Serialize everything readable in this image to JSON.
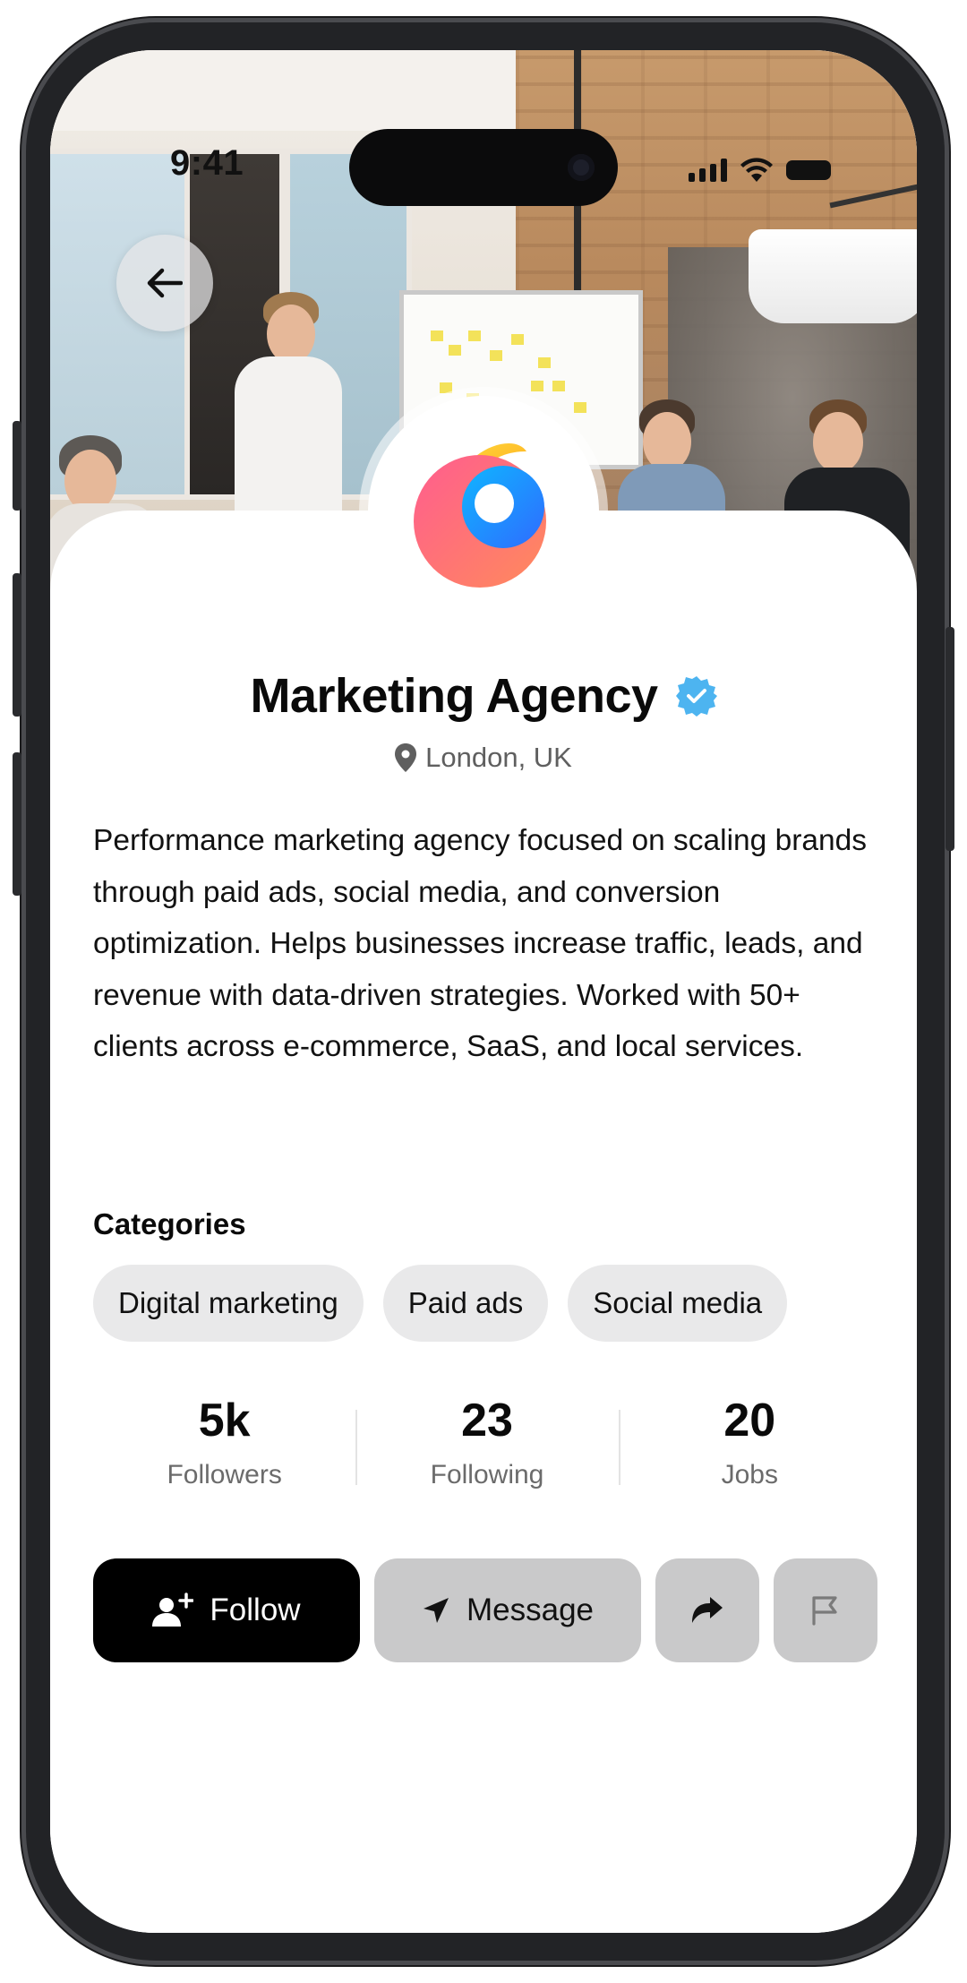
{
  "status_bar": {
    "time": "9:41"
  },
  "profile": {
    "name": "Marketing Agency",
    "verified": true,
    "location": "London, UK",
    "bio": "Performance marketing agency focused on scaling brands through paid ads, social media, and conversion optimization. Helps businesses increase traffic, leads, and revenue with data-driven strategies. Worked with 50+ clients across e-commerce, SaaS, and local services."
  },
  "categories": {
    "title": "Categories",
    "items": [
      "Digital marketing",
      "Paid ads",
      "Social media"
    ]
  },
  "stats": [
    {
      "value": "5k",
      "label": "Followers"
    },
    {
      "value": "23",
      "label": "Following"
    },
    {
      "value": "20",
      "label": "Jobs"
    }
  ],
  "actions": {
    "follow_label": "Follow",
    "message_label": "Message"
  },
  "icons": {
    "back": "arrow-left-icon",
    "location": "location-pin-icon",
    "verified": "verified-badge-icon",
    "follow": "add-user-icon",
    "message": "send-icon",
    "share": "share-arrow-icon",
    "report": "flag-icon"
  },
  "colors": {
    "verified_badge": "#4db4f0",
    "follow_button": "#000000",
    "secondary_button": "#c9c9ca",
    "chip_bg": "#e9e9ea"
  }
}
